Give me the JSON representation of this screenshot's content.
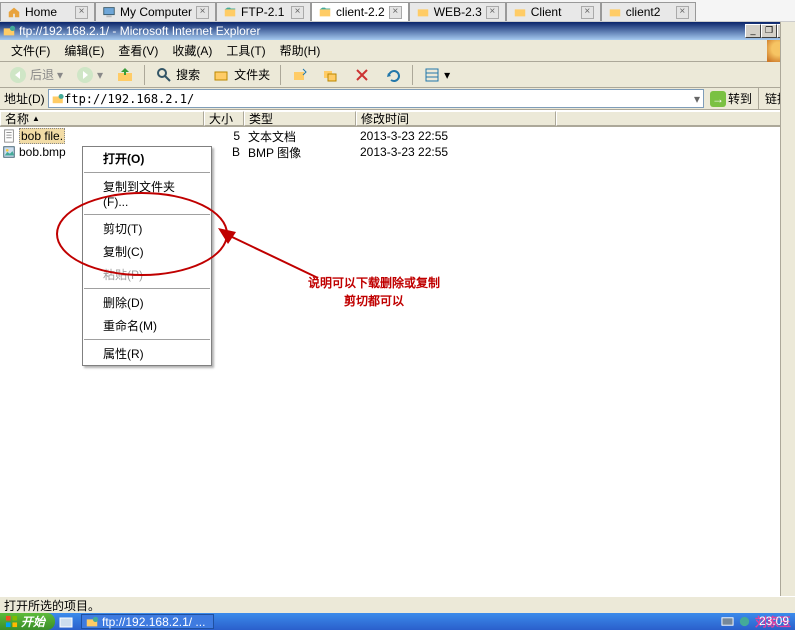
{
  "tabs": [
    {
      "label": "Home",
      "active": false
    },
    {
      "label": "My Computer",
      "active": false
    },
    {
      "label": "FTP-2.1",
      "active": false
    },
    {
      "label": "client-2.2",
      "active": true
    },
    {
      "label": "WEB-2.3",
      "active": false
    },
    {
      "label": "Client",
      "active": false
    },
    {
      "label": "client2",
      "active": false
    }
  ],
  "window": {
    "title": "ftp://192.168.2.1/ - Microsoft Internet Explorer"
  },
  "menu": {
    "file": "文件(F)",
    "edit": "编辑(E)",
    "view": "查看(V)",
    "fav": "收藏(A)",
    "tools": "工具(T)",
    "help": "帮助(H)"
  },
  "toolbar": {
    "back": "后退",
    "search": "搜索",
    "folders": "文件夹"
  },
  "address": {
    "label": "地址(D)",
    "url": "ftp://192.168.2.1/",
    "go": "转到",
    "links": "链接"
  },
  "columns": {
    "name": "名称",
    "size": "大小",
    "type": "类型",
    "modified": "修改时间"
  },
  "files": [
    {
      "name": "bob file.",
      "size": "5",
      "type": "文本文档",
      "modified": "2013-3-23 22:55",
      "selected": true,
      "icon": "text"
    },
    {
      "name": "bob.bmp",
      "size": "B",
      "type": "BMP 图像",
      "modified": "2013-3-23 22:55",
      "selected": false,
      "icon": "bmp"
    }
  ],
  "context": {
    "open": "打开(O)",
    "copyto": "复制到文件夹(F)...",
    "cut": "剪切(T)",
    "copy": "复制(C)",
    "paste": "粘贴(P)",
    "delete": "删除(D)",
    "rename": "重命名(M)",
    "props": "属性(R)"
  },
  "annotation": {
    "line1": "说明可以下载删除或复制",
    "line2": "剪切都可以"
  },
  "status": "打开所选的项目。",
  "taskbar": {
    "start": "开始",
    "task": "ftp://192.168.2.1/ ...",
    "clock": "23:09",
    "signature": "刘家玉"
  }
}
